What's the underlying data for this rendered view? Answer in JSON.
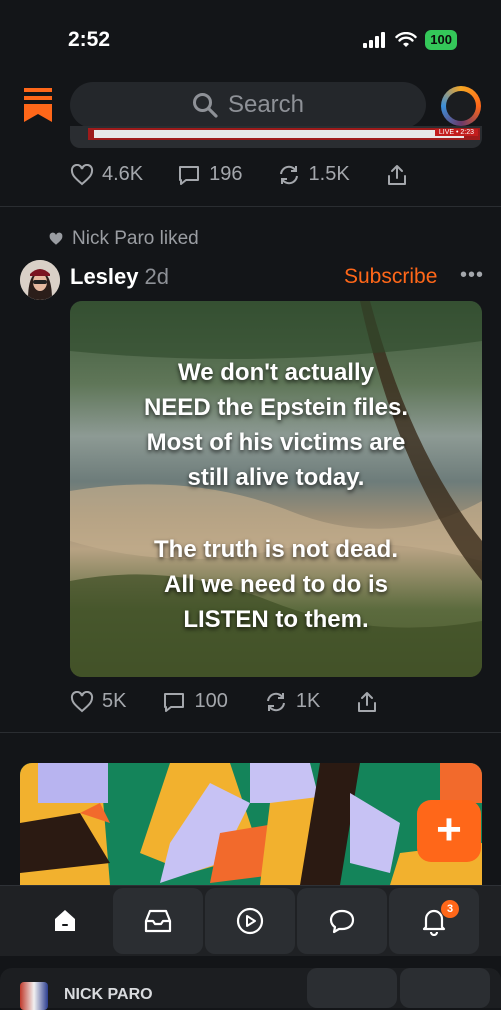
{
  "status_bar": {
    "time": "2:52",
    "battery": "100"
  },
  "header": {
    "search_placeholder": "Search"
  },
  "previous_post": {
    "badge_text": "LIVE • 2:23",
    "likes": "4.6K",
    "comments": "196",
    "restacks": "1.5K"
  },
  "activity": {
    "liked_by": "Nick Paro liked"
  },
  "post": {
    "author": "Lesley",
    "age": "2d",
    "subscribe_label": "Subscribe",
    "more_label": "•••",
    "image_text": [
      "We don't actually",
      "NEED the Epstein files.",
      "Most of his victims are",
      "still alive today.",
      "The truth is not dead.",
      "All we need to do is",
      "LISTEN to them."
    ],
    "likes": "5K",
    "comments": "100",
    "restacks": "1K"
  },
  "fab_label": "+",
  "tabbar": {
    "notification_count": "3"
  },
  "mini_player": {
    "title": "NICK PARO"
  },
  "colors": {
    "accent": "#ff6719",
    "background": "#131518",
    "battery": "#34c759"
  }
}
